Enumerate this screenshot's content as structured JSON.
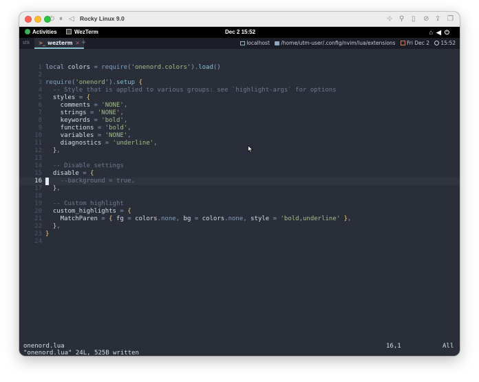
{
  "vm_window": {
    "title": "Rocky Linux 9.0"
  },
  "gnome_bar": {
    "activities": "Activities",
    "app": "WezTerm",
    "clock": "Dec 2  15:52"
  },
  "terminal_tabs": {
    "workspace": "stk",
    "active_tab": "wezterm",
    "new_tab": "+"
  },
  "status_right": {
    "host": "localhost",
    "path": "/home/utm-user/.config/nvim/lua/extensions",
    "date": "Fri Dec 2",
    "time": "15:52"
  },
  "editor": {
    "cursor_line": 16,
    "lines": [
      {
        "n": "1",
        "segs": [
          [
            "kw",
            "local "
          ],
          [
            "var",
            "colors "
          ],
          [
            "op",
            "= "
          ],
          [
            "req",
            "require"
          ],
          [
            "par",
            "("
          ],
          [
            "str",
            "'onenord.colors'"
          ],
          [
            "par",
            ")"
          ],
          [
            "pun",
            "."
          ],
          [
            "fn",
            "load"
          ],
          [
            "par",
            "()"
          ]
        ]
      },
      {
        "n": "2",
        "segs": []
      },
      {
        "n": "3",
        "segs": [
          [
            "req",
            "require"
          ],
          [
            "par",
            "("
          ],
          [
            "str",
            "'onenord'"
          ],
          [
            "par",
            ")"
          ],
          [
            "pun",
            "."
          ],
          [
            "fn",
            "setup "
          ],
          [
            "brk",
            "{"
          ]
        ]
      },
      {
        "n": "4",
        "segs": [
          [
            "cmt",
            "  -- Style that is applied to various groups: see `highlight-args` for options"
          ]
        ]
      },
      {
        "n": "5",
        "segs": [
          [
            "fld",
            "  styles "
          ],
          [
            "op",
            "= "
          ],
          [
            "brk",
            "{"
          ]
        ]
      },
      {
        "n": "6",
        "segs": [
          [
            "fld",
            "    comments "
          ],
          [
            "op",
            "= "
          ],
          [
            "str",
            "'NONE'"
          ],
          [
            "pun",
            ","
          ]
        ]
      },
      {
        "n": "7",
        "segs": [
          [
            "fld",
            "    strings "
          ],
          [
            "op",
            "= "
          ],
          [
            "str",
            "'NONE'"
          ],
          [
            "pun",
            ","
          ]
        ]
      },
      {
        "n": "8",
        "segs": [
          [
            "fld",
            "    keywords "
          ],
          [
            "op",
            "= "
          ],
          [
            "str",
            "'bold'"
          ],
          [
            "pun",
            ","
          ]
        ]
      },
      {
        "n": "9",
        "segs": [
          [
            "fld",
            "    functions "
          ],
          [
            "op",
            "= "
          ],
          [
            "str",
            "'bold'"
          ],
          [
            "pun",
            ","
          ]
        ]
      },
      {
        "n": "10",
        "segs": [
          [
            "fld",
            "    variables "
          ],
          [
            "op",
            "= "
          ],
          [
            "str",
            "'NONE'"
          ],
          [
            "pun",
            ","
          ]
        ]
      },
      {
        "n": "11",
        "segs": [
          [
            "fld",
            "    diagnostics "
          ],
          [
            "op",
            "= "
          ],
          [
            "str",
            "'underline'"
          ],
          [
            "pun",
            ","
          ]
        ]
      },
      {
        "n": "12",
        "segs": [
          [
            "brk",
            "  }"
          ],
          [
            "pun",
            ","
          ]
        ]
      },
      {
        "n": "13",
        "segs": []
      },
      {
        "n": "14",
        "segs": [
          [
            "cmt",
            "  -- Disable settings"
          ]
        ]
      },
      {
        "n": "15",
        "segs": [
          [
            "fld",
            "  disable "
          ],
          [
            "op",
            "= "
          ],
          [
            "brk",
            "{"
          ]
        ]
      },
      {
        "n": "16",
        "segs": [
          [
            "cmt",
            "    --background = true,"
          ]
        ]
      },
      {
        "n": "17",
        "segs": [
          [
            "brk",
            "  }"
          ],
          [
            "pun",
            ","
          ]
        ]
      },
      {
        "n": "18",
        "segs": []
      },
      {
        "n": "19",
        "segs": [
          [
            "cmt",
            "  -- Custom highlight"
          ]
        ]
      },
      {
        "n": "20",
        "segs": [
          [
            "fld",
            "  custom_highlights "
          ],
          [
            "op",
            "= "
          ],
          [
            "brk",
            "{"
          ]
        ]
      },
      {
        "n": "21",
        "segs": [
          [
            "fld",
            "    MatchParen "
          ],
          [
            "op",
            "= "
          ],
          [
            "brk",
            "{ "
          ],
          [
            "fld",
            "fg "
          ],
          [
            "op",
            "= "
          ],
          [
            "var",
            "colors"
          ],
          [
            "pun",
            "."
          ],
          [
            "prop",
            "none"
          ],
          [
            "pun",
            ", "
          ],
          [
            "fld",
            "bg "
          ],
          [
            "op",
            "= "
          ],
          [
            "var",
            "colors"
          ],
          [
            "pun",
            "."
          ],
          [
            "prop",
            "none"
          ],
          [
            "pun",
            ", "
          ],
          [
            "fld",
            "style "
          ],
          [
            "op",
            "= "
          ],
          [
            "str",
            "'bold,underline' "
          ],
          [
            "brk",
            "}"
          ],
          [
            "pun",
            ","
          ]
        ]
      },
      {
        "n": "22",
        "segs": [
          [
            "brk",
            "  }"
          ],
          [
            "pun",
            ","
          ]
        ]
      },
      {
        "n": "23",
        "segs": [
          [
            "brk",
            "}"
          ]
        ]
      },
      {
        "n": "24",
        "segs": []
      }
    ]
  },
  "statusline": {
    "file": "onenord.lua",
    "position": "16,1",
    "scroll": "All"
  },
  "message": "\"onenord.lua\" 24L, 525B written",
  "colors": {
    "bg": "#2a2e38",
    "string": "#a3be8c",
    "function": "#88c0d0",
    "bracket": "#ebcb8b",
    "comment": "#6e7a8f"
  }
}
